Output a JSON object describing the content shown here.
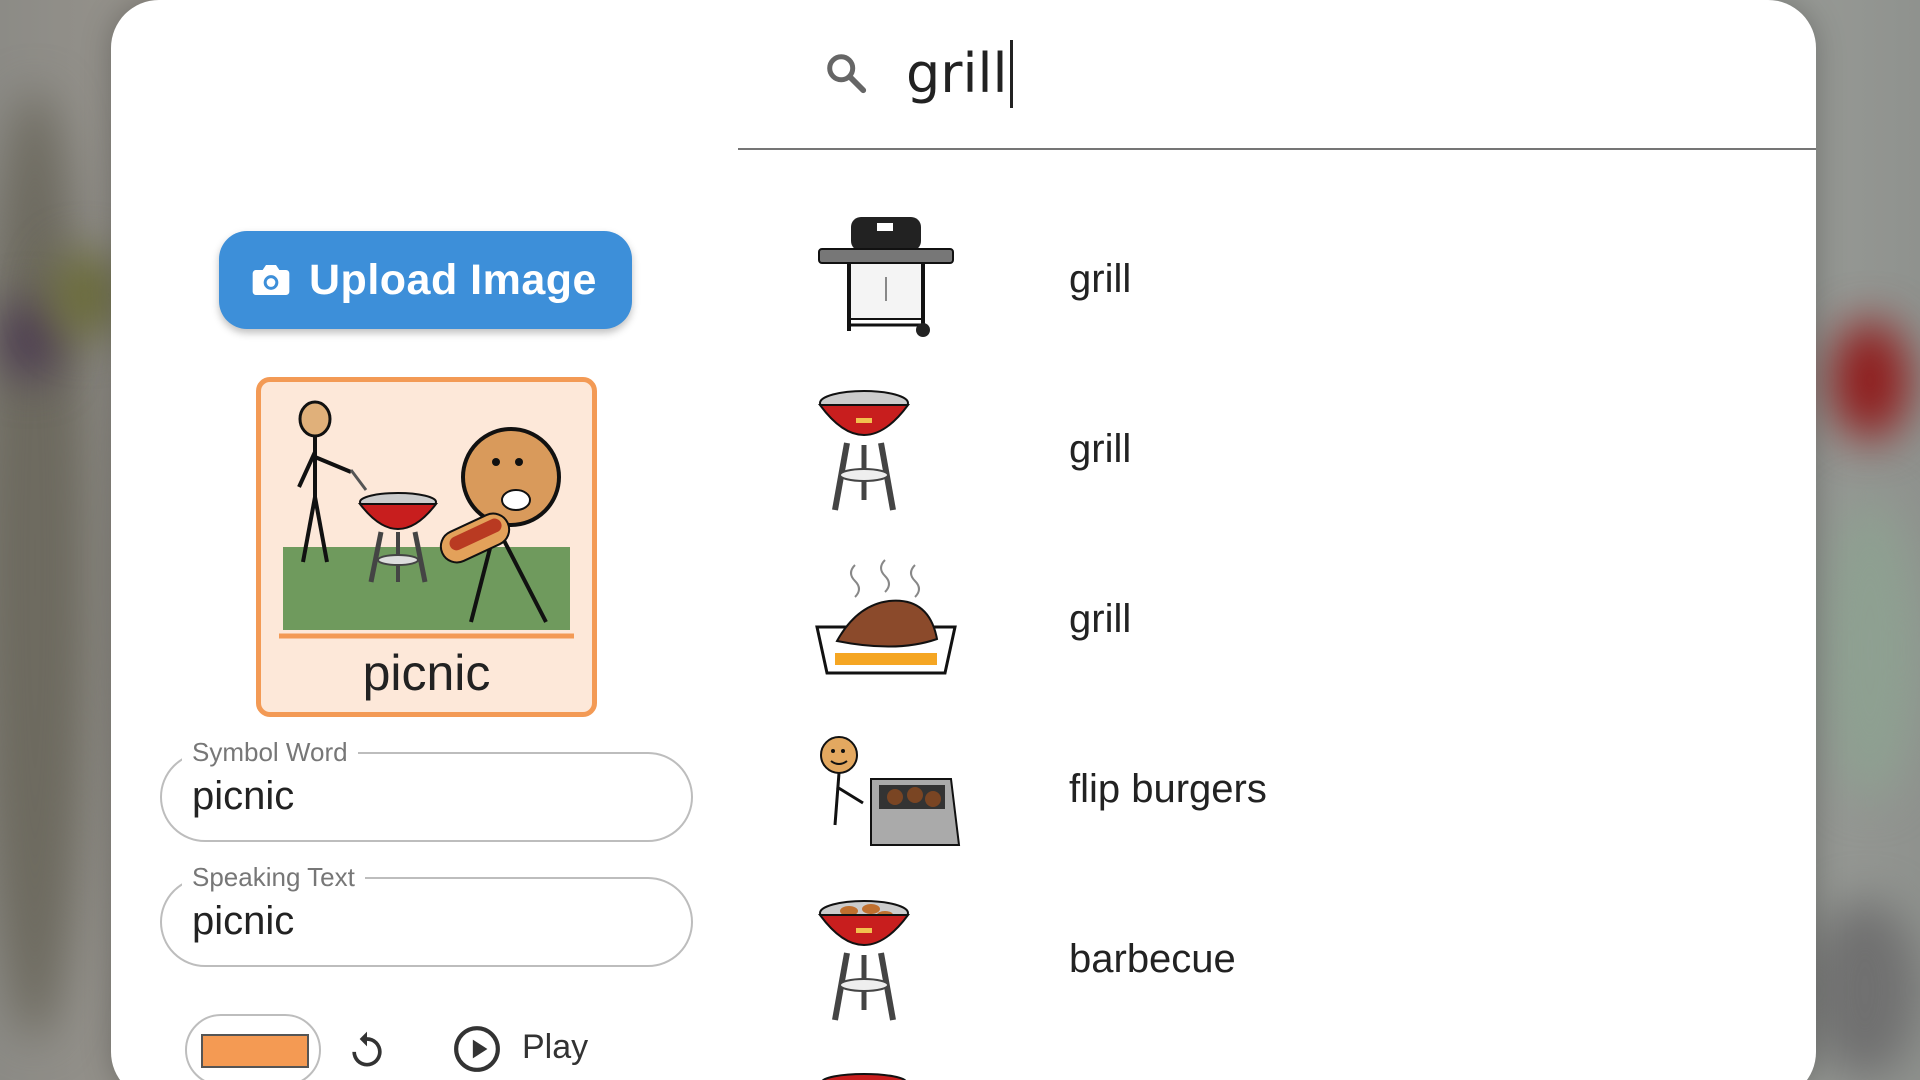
{
  "search": {
    "query": "grill",
    "providers": [
      "google-icon",
      "square-icon"
    ]
  },
  "editor": {
    "upload_label": "Upload Image",
    "card_word": "picnic",
    "symbol_word_label": "Symbol Word",
    "symbol_word_value": "picnic",
    "speaking_text_label": "Speaking Text",
    "speaking_text_value": "picnic",
    "color": "#f49a53",
    "play_label": "Play"
  },
  "results": [
    {
      "label": "grill",
      "icon": "gas-grill-icon"
    },
    {
      "label": "grill",
      "icon": "kettle-grill-icon"
    },
    {
      "label": "grill",
      "icon": "steak-on-grill-icon"
    },
    {
      "label": "flip burgers",
      "icon": "flip-burgers-icon"
    },
    {
      "label": "barbecue",
      "icon": "barbecue-icon"
    }
  ],
  "colors": {
    "accent": "#3d8fd9",
    "card_border": "#f39a55",
    "card_bg": "#fde8d9"
  }
}
